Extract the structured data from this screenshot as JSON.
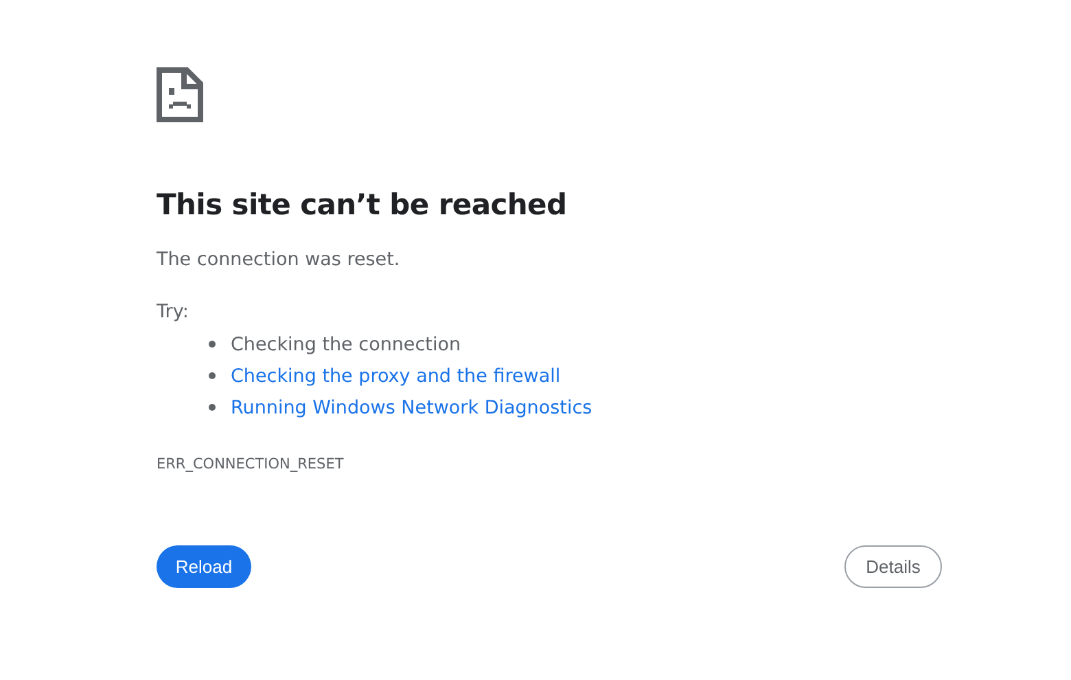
{
  "heading": "This site can’t be reached",
  "message": "The connection was reset.",
  "try_label": "Try:",
  "suggestions": [
    {
      "kind": "text",
      "label": "Checking the connection"
    },
    {
      "kind": "link",
      "label": "Checking the proxy and the firewall"
    },
    {
      "kind": "link",
      "label": "Running Windows Network Diagnostics"
    }
  ],
  "error_code": "ERR_CONNECTION_RESET",
  "buttons": {
    "primary": "Reload",
    "secondary": "Details"
  }
}
